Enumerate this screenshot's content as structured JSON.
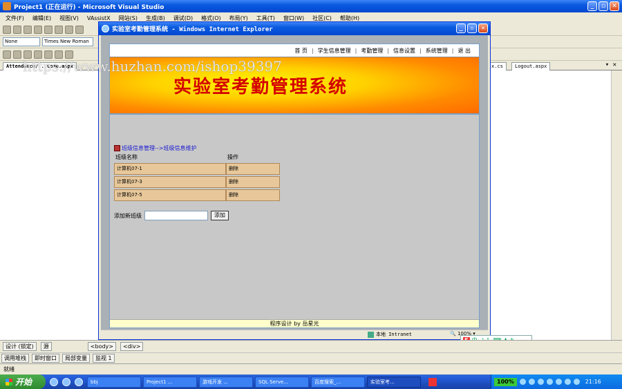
{
  "vs": {
    "title": "Project1 (正在运行) - Microsoft Visual Studio",
    "menu": [
      "文件(F)",
      "编辑(E)",
      "视图(V)",
      "VAssistX",
      "网站(S)",
      "生成(B)",
      "调试(D)",
      "格式(O)",
      "布局(Y)",
      "工具(T)",
      "窗口(W)",
      "社区(C)",
      "帮助(H)"
    ],
    "style_combo": "None",
    "font_combo": "Times New Roman",
    "tabs": [
      "Attendance/...Come.aspx",
      "x.cs",
      "Logout.aspx"
    ],
    "design_tab": "设计 (锁定)",
    "source_tab": "源",
    "tag_body": "<body>",
    "tag_div": "<div>",
    "bottom_tabs": [
      "调用堆栈",
      "即时窗口",
      "局部变量",
      "监视 1"
    ],
    "status": "就绪"
  },
  "ie": {
    "title": "实验室考勤管理系统 - Windows Internet Explorer",
    "zone": "本地 Intranet",
    "zoom": "100%"
  },
  "page": {
    "nav": [
      "首 页",
      "学生信息管理",
      "考勤管理",
      "信息设置",
      "系统管理",
      "退 出"
    ],
    "banner_title": "实验室考勤管理系统",
    "watermark": "https://www.huzhan.com/ishop39397",
    "breadcrumb": "班级信息管理-->班级信息维护",
    "grid": {
      "headers": [
        "班级名称",
        "操作"
      ],
      "rows": [
        {
          "name": "计算机07-1",
          "action": "删除"
        },
        {
          "name": "计算机07-3",
          "action": "删除"
        },
        {
          "name": "计算机07-5",
          "action": "删除"
        }
      ]
    },
    "add_label": "添加新班级",
    "add_value": "",
    "add_button": "添加",
    "footer": "程序设计 by 岳星光"
  },
  "taskbar": {
    "start": "开始",
    "tasks": [
      "bbj",
      "Project1 ...",
      "游戏开发 ...",
      "SQL Serve...",
      "百度搜索_...",
      "实验室考..."
    ],
    "zoom": "100%",
    "clock": "21:16"
  },
  "ime": {
    "mode": "中"
  }
}
